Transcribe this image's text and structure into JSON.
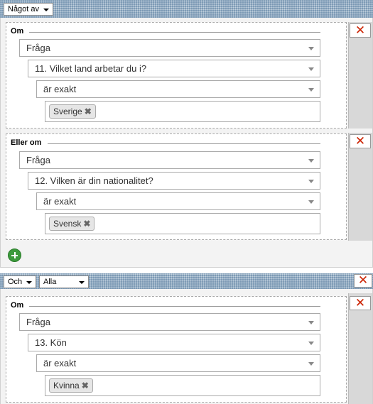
{
  "groups": [
    {
      "match_select": "Något av",
      "conditions": [
        {
          "title": "Om",
          "source": "Fråga",
          "question": "11. Vilket land arbetar du i?",
          "operator": "är exakt",
          "tag": "Sverige"
        },
        {
          "title": "Eller om",
          "source": "Fråga",
          "question": "12. Vilken är din nationalitet?",
          "operator": "är exakt",
          "tag": "Svensk"
        }
      ]
    },
    {
      "join_select": "Och",
      "match_select": "Alla",
      "conditions": [
        {
          "title": "Om",
          "source": "Fråga",
          "question": "13. Kön",
          "operator": "är exakt",
          "tag": "Kvinna"
        }
      ]
    }
  ],
  "tag_remove_glyph": "✖",
  "close_glyph": "✕",
  "colors": {
    "header_bg": "#7d9ab5",
    "close_red": "#cc2200",
    "add_green": "#3c9a3c"
  }
}
